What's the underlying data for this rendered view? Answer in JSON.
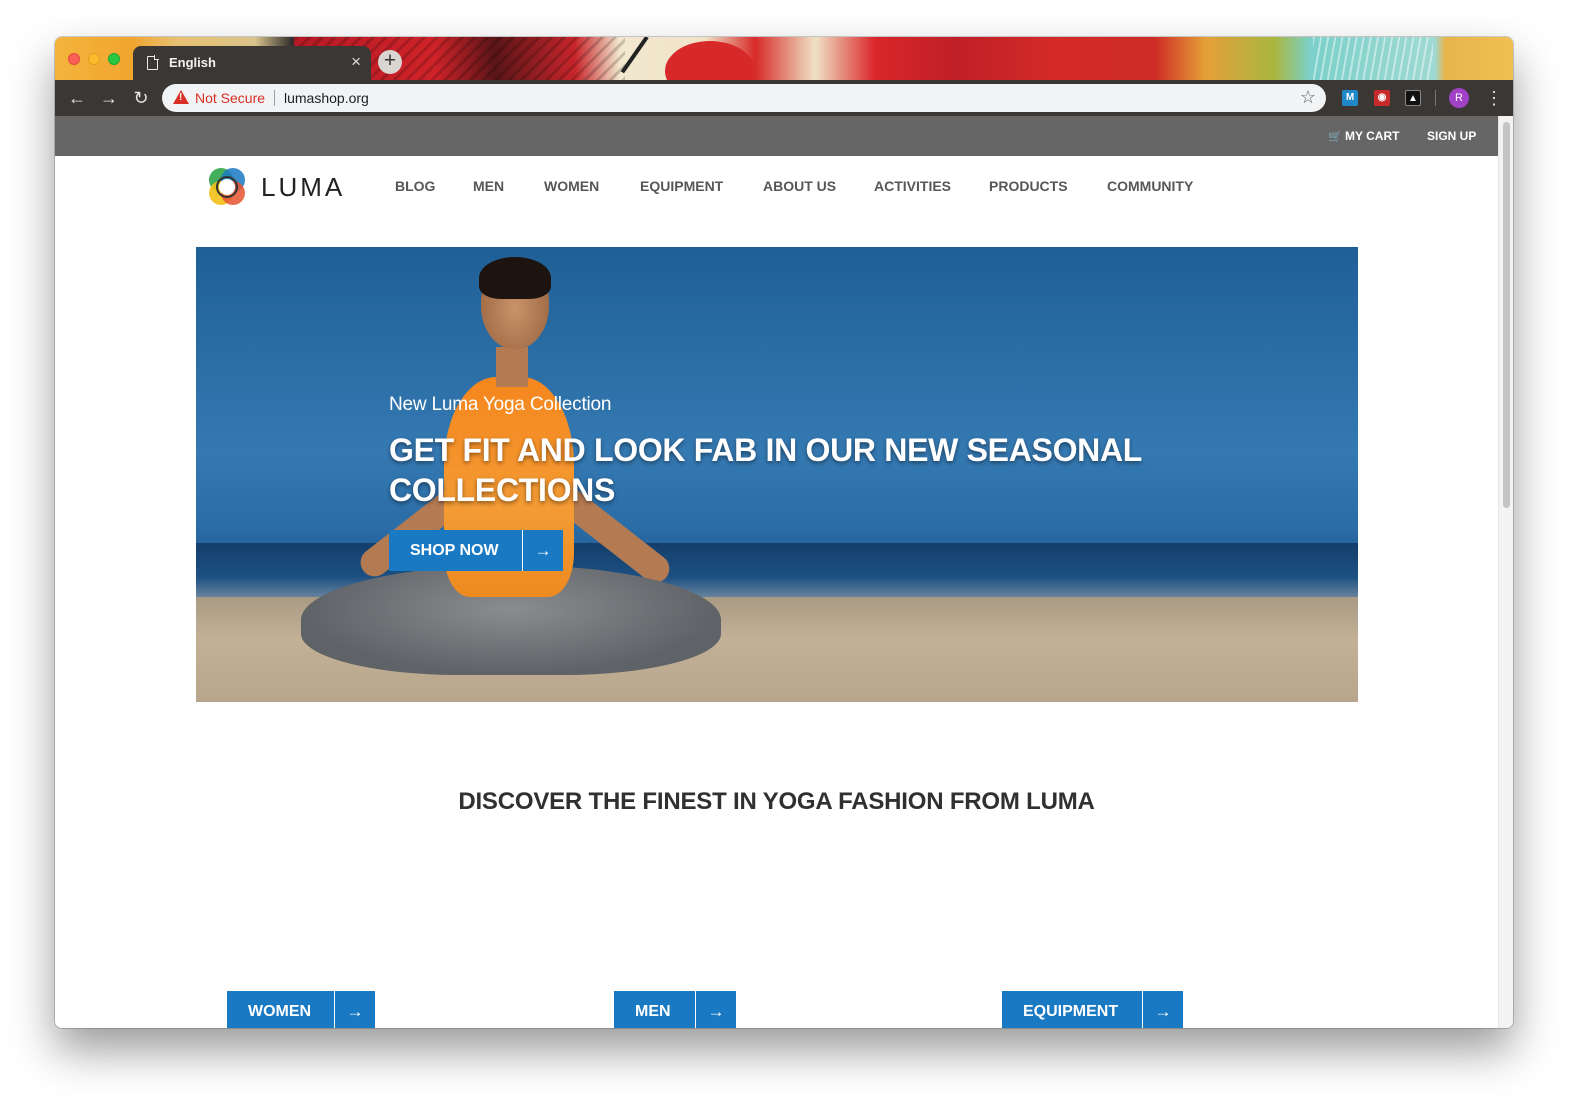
{
  "browser": {
    "tab_title": "English",
    "tab_close": "×",
    "new_tab": "+",
    "security_label": "Not Secure",
    "url": "lumashop.org",
    "profile_initial": "R",
    "extensions": [
      "M",
      "",
      ""
    ]
  },
  "topbar": {
    "cart_label": "MY CART",
    "signup_label": "SIGN UP"
  },
  "header": {
    "logo_text": "LUMA",
    "nav": [
      "BLOG",
      "MEN",
      "WOMEN",
      "EQUIPMENT",
      "ABOUT US",
      "ACTIVITIES",
      "PRODUCTS",
      "COMMUNITY"
    ]
  },
  "hero": {
    "subtitle": "New Luma Yoga Collection",
    "headline": "GET FIT AND LOOK FAB IN OUR NEW SEASONAL COLLECTIONS",
    "cta_label": "SHOP NOW"
  },
  "discover": {
    "heading": "DISCOVER THE FINEST IN YOGA FASHION FROM LUMA"
  },
  "categories": {
    "women": "WOMEN",
    "men": "MEN",
    "equipment": "EQUIPMENT"
  },
  "colors": {
    "accent": "#1979c3",
    "topbar": "#666666",
    "insecure": "#d93025"
  }
}
